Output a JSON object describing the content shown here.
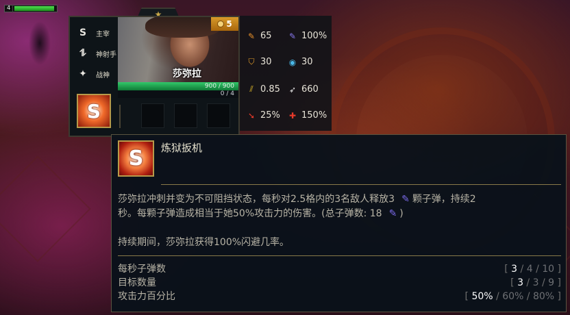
{
  "player": {
    "level_marker": "4"
  },
  "unit": {
    "name": "莎弥拉",
    "cost": "5",
    "hp_text": "900 / 900",
    "mana_text": "0 / 4",
    "hp_fraction": 1.0,
    "mana_fraction": 0.0,
    "traits": [
      {
        "label": "主宰",
        "icon": "dominator-trait-icon",
        "glyph": "S"
      },
      {
        "label": "神射手",
        "icon": "marksman-trait-icon",
        "glyph": "⥮"
      },
      {
        "label": "战神",
        "icon": "wargod-trait-icon",
        "glyph": "✦"
      }
    ],
    "ability_glyph": "S",
    "item_slots": 3
  },
  "stats": {
    "attack_damage": "65",
    "ability_power": "100%",
    "armor": "30",
    "magic_resist": "30",
    "attack_speed": "0.85",
    "range": "660",
    "crit_chance": "25%",
    "crit_damage": "150%"
  },
  "ability": {
    "name": "炼狱扳机",
    "glyph": "S",
    "desc_line1_pre": "莎弥拉冲刺并变为不可阻挡状态，每秒对2.5格内的3名敌人释放3",
    "desc_line1_post": "颗子弹，持续2",
    "desc_line2_pre": "秒。每颗子弹造成相当于她50%攻击力的伤害。(总子弹数: 18",
    "desc_line2_post": ")",
    "desc_line3": "持续期间，莎弥拉获得100%闪避几率。",
    "scalings": [
      {
        "label": "每秒子弹数",
        "open": "[ ",
        "v1": "3",
        "sep1": " / ",
        "v2": "4",
        "sep2": " / ",
        "v3": "10",
        "close": " ]"
      },
      {
        "label": "目标数量",
        "open": "[ ",
        "v1": "3",
        "sep1": " / ",
        "v2": "3",
        "sep2": " / ",
        "v3": "9",
        "close": " ]"
      },
      {
        "label": "攻击力百分比",
        "open": "[ ",
        "v1": "50%",
        "sep1": " / ",
        "v2": "60%",
        "sep2": " / ",
        "v3": "80%",
        "close": " ]"
      }
    ]
  },
  "colors": {
    "hp_green": "#1fa04a",
    "gold_border": "#b89a4a",
    "mana_icon": "#7a6ae8"
  }
}
